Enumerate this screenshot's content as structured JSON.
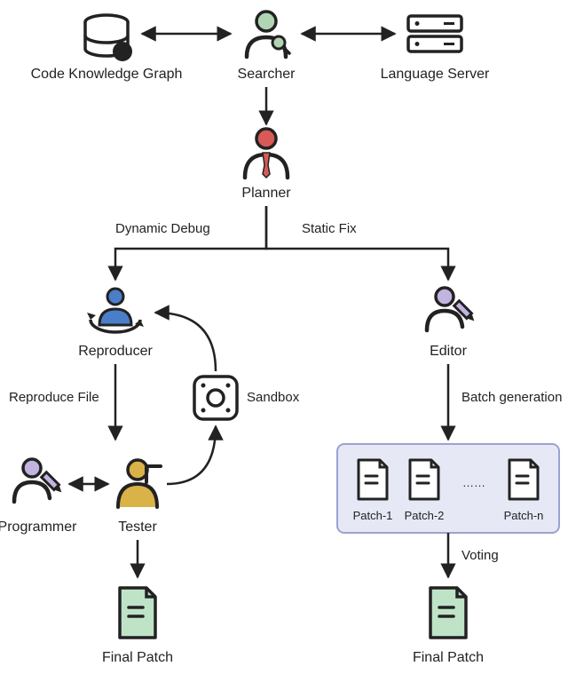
{
  "nodes": {
    "ckg": "Code Knowledge Graph",
    "searcher": "Searcher",
    "lang_server": "Language Server",
    "planner": "Planner",
    "reproducer": "Reproducer",
    "editor": "Editor",
    "sandbox": "Sandbox",
    "tester": "Tester",
    "programmer": "Programmer",
    "final_patch_left": "Final Patch",
    "final_patch_right": "Final Patch"
  },
  "edges": {
    "dynamic_debug": "Dynamic Debug",
    "static_fix": "Static Fix",
    "reproduce_file": "Reproduce File",
    "batch_generation": "Batch generation",
    "voting": "Voting"
  },
  "patches": {
    "p1": "Patch-1",
    "p2": "Patch-2",
    "ellipsis": "……",
    "pn": "Patch-n"
  },
  "colors": {
    "searcher_head": "#b1d5b3",
    "planner_head": "#d85a56",
    "reproducer_head": "#4a7ec9",
    "editor_head": "#c2b3e0",
    "tester_head": "#d9b347",
    "programmer_head": "#c2b3e0",
    "patch_fill": "#bfe3c7",
    "box_fill": "#e6e9f5",
    "box_stroke": "#9aa3d0"
  }
}
